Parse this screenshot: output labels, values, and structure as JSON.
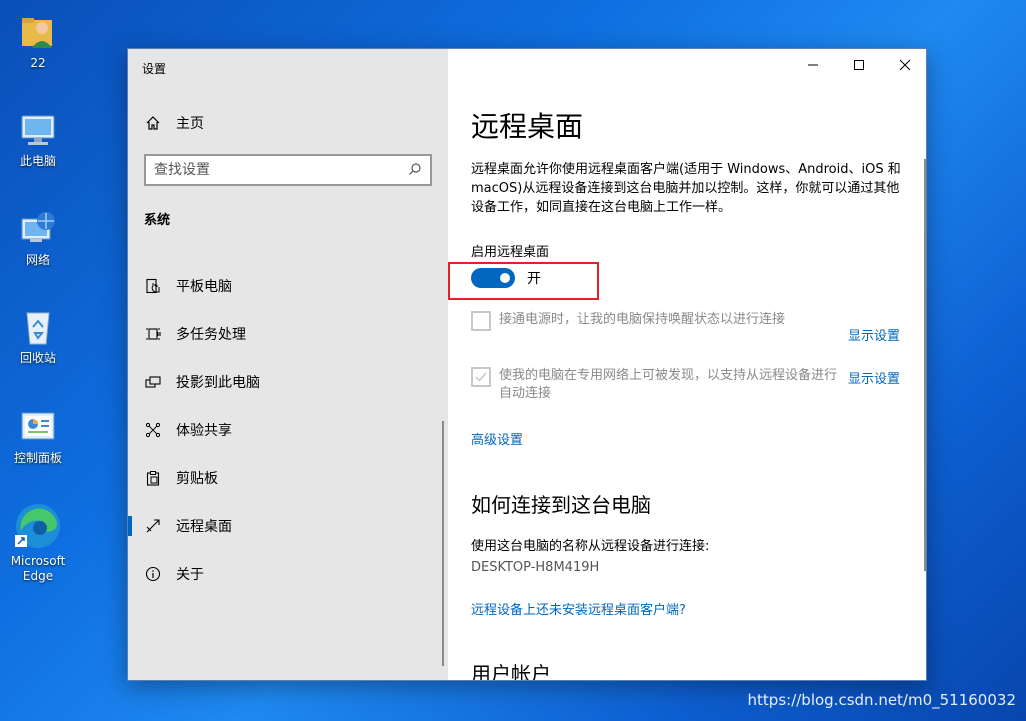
{
  "desktop": {
    "icons": [
      {
        "label": "22"
      },
      {
        "label": "此电脑"
      },
      {
        "label": "网络"
      },
      {
        "label": "回收站"
      },
      {
        "label": "控制面板"
      },
      {
        "label": "Microsoft Edge"
      }
    ]
  },
  "window": {
    "title": "设置",
    "controls": {
      "minimize": "—",
      "maximize": "☐",
      "close": "✕"
    }
  },
  "sidebar": {
    "home_label": "主页",
    "search_placeholder": "查找设置",
    "section_heading": "系统",
    "items": [
      {
        "label": "平板电脑",
        "icon": "tablet-icon"
      },
      {
        "label": "多任务处理",
        "icon": "multitask-icon"
      },
      {
        "label": "投影到此电脑",
        "icon": "project-icon"
      },
      {
        "label": "体验共享",
        "icon": "share-icon"
      },
      {
        "label": "剪贴板",
        "icon": "clipboard-icon"
      },
      {
        "label": "远程桌面",
        "icon": "remote-desktop-icon",
        "active": true
      },
      {
        "label": "关于",
        "icon": "info-icon"
      }
    ]
  },
  "main": {
    "title": "远程桌面",
    "description": "远程桌面允许你使用远程桌面客户端(适用于 Windows、Android、iOS 和 macOS)从远程设备连接到这台电脑并加以控制。这样，你就可以通过其他设备工作，如同直接在这台电脑上工作一样。",
    "enable_label": "启用远程桌面",
    "toggle_state": "开",
    "toggle_on": true,
    "option1": {
      "text": "接通电源时，让我的电脑保持唤醒状态以进行连接",
      "checked": false,
      "link": "显示设置"
    },
    "option2": {
      "text": "使我的电脑在专用网络上可被发现，以支持从远程设备进行自动连接",
      "checked": true,
      "link": "显示设置"
    },
    "advanced_link": "高级设置",
    "how_to_heading": "如何连接到这台电脑",
    "how_to_text": "使用这台电脑的名称从远程设备进行连接:",
    "pc_name": "DESKTOP-H8M419H",
    "no_client_link": "远程设备上还未安装远程桌面客户端?",
    "user_accounts_heading": "用户帐户"
  },
  "watermark": "https://blog.csdn.net/m0_51160032",
  "colors": {
    "accent": "#0067c0",
    "highlight_box": "#e0232a"
  }
}
